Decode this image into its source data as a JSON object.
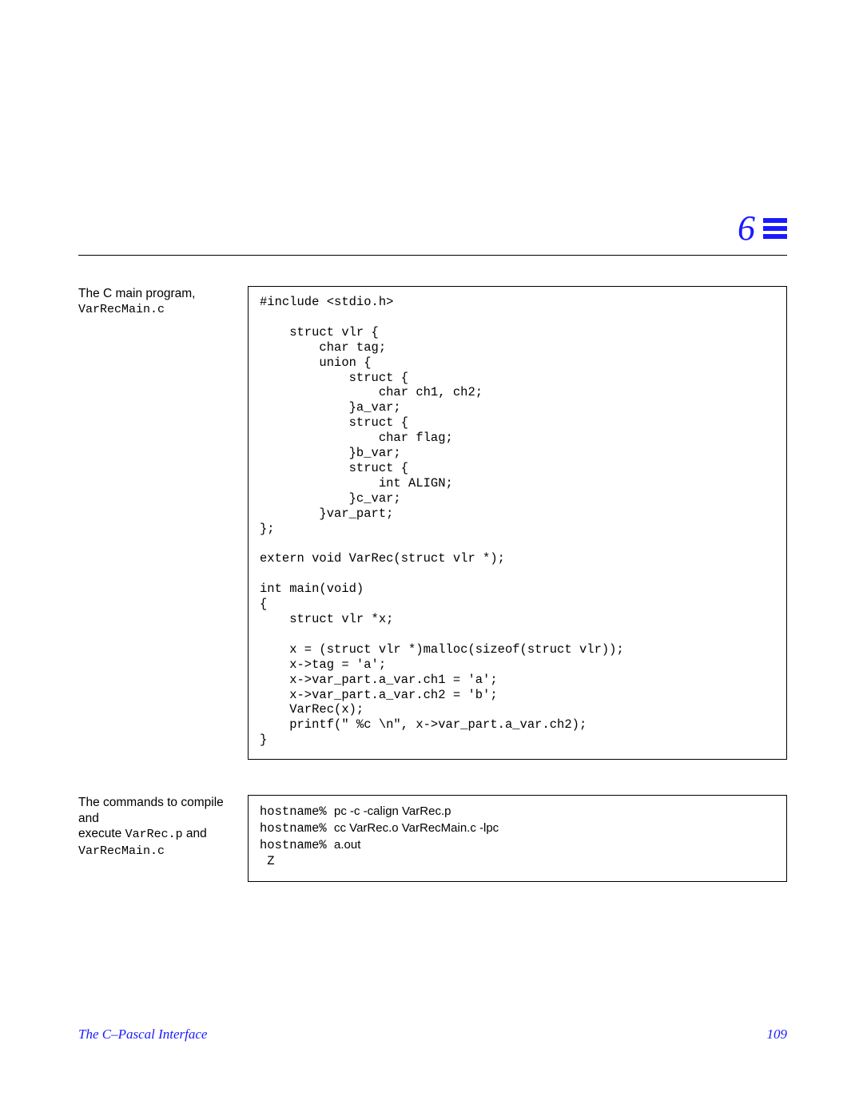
{
  "chapter_number": "6",
  "block1": {
    "desc_line1": "The C main program,",
    "desc_filename": "VarRecMain.c",
    "code": "#include <stdio.h>\n\n    struct vlr {\n        char tag;\n        union {\n            struct {\n                char ch1, ch2;\n            }a_var;\n            struct {\n                char flag;\n            }b_var;\n            struct {\n                int ALIGN;\n            }c_var;\n        }var_part;\n};\n\nextern void VarRec(struct vlr *);\n\nint main(void)\n{\n    struct vlr *x;\n\n    x = (struct vlr *)malloc(sizeof(struct vlr));\n    x->tag = 'a';\n    x->var_part.a_var.ch1 = 'a';\n    x->var_part.a_var.ch2 = 'b';\n    VarRec(x);\n    printf(\" %c \\n\", x->var_part.a_var.ch2);\n}"
  },
  "block2": {
    "desc_line1": "The commands to compile and",
    "desc_line2_a": "execute ",
    "desc_file1": "VarRec.p",
    "desc_line2_b": " and",
    "desc_file2": "VarRecMain.c",
    "prompt": "hostname% ",
    "cmd1": "pc -c -calign VarRec.p",
    "cmd2": "cc VarRec.o VarRecMain.c -lpc",
    "cmd3": "a.out",
    "output": " Z"
  },
  "footer": {
    "title": "The C–Pascal Interface",
    "page": "109"
  }
}
